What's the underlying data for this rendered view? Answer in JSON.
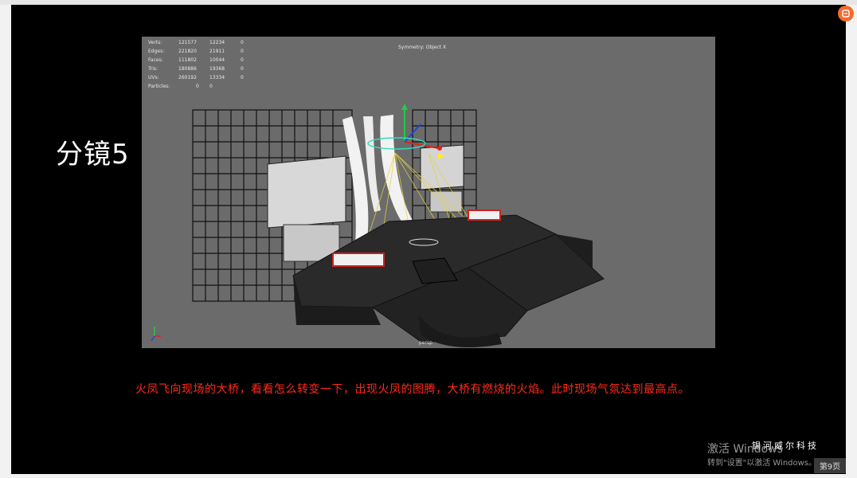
{
  "slide": {
    "shot_label": "分镜5",
    "caption": "火凤飞向现场的大桥，看看怎么转变一下，出现火凤的图腾，大桥有燃烧的火焰。此时现场气氛达到最高点。",
    "brand": "锡河威尔科技",
    "page_number": "第9页"
  },
  "viewport": {
    "stats": [
      {
        "label": "Verts:",
        "v1": "121577",
        "v2": "12234",
        "v3": "0"
      },
      {
        "label": "Edges:",
        "v1": "221820",
        "v2": "21911",
        "v3": "0"
      },
      {
        "label": "Faces:",
        "v1": "111802",
        "v2": "10044",
        "v3": "0"
      },
      {
        "label": "Tris:",
        "v1": "180886",
        "v2": "19368",
        "v3": "0"
      },
      {
        "label": "UVs:",
        "v1": "260192",
        "v2": "13334",
        "v3": "0"
      }
    ],
    "particles_label": "Particles:",
    "particles_v1": "0",
    "particles_v2": "0",
    "symmetry": "Symmetry: Object X",
    "camera": "persp"
  },
  "os_watermark": {
    "line1": "激活 Windows",
    "line2": "转到\"设置\"以激活 Windows。"
  },
  "colors": {
    "slide_bg": "#000000",
    "viewport_bg": "#6b6b6b",
    "caption": "#ff2a1a",
    "corner_icon": "#f46a2c"
  },
  "icons": [
    "app-corner-icon",
    "axis-gizmo-icon",
    "transform-manipulator-icon"
  ]
}
